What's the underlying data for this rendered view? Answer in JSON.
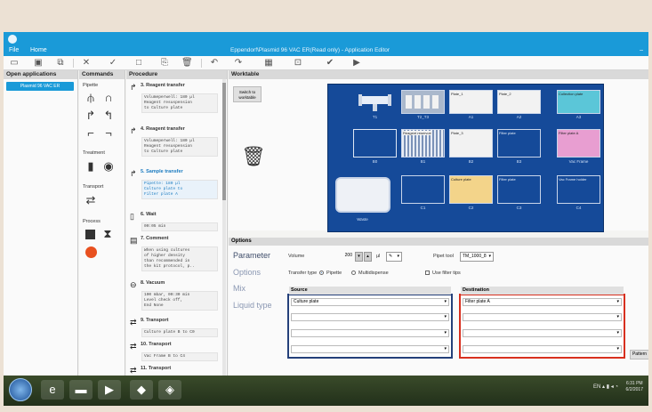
{
  "window": {
    "title": "Eppendorf\\Plasmid 96 VAC ER(Read only) - Application Editor",
    "menu": [
      "File",
      "Home"
    ]
  },
  "toolbar": {
    "icons": [
      "save-icon",
      "save-as-icon",
      "copy-icon",
      "close-icon",
      "check-icon",
      "new-icon",
      "paste-icon",
      "delete-icon",
      "undo-icon",
      "redo-icon",
      "table-icon",
      "preview-icon",
      "validate-icon",
      "run-icon"
    ]
  },
  "open_applications": {
    "header": "Open applications",
    "active_app": "Plasmid 96 VAC ER"
  },
  "commands": {
    "header": "Commands",
    "groups": {
      "pipette": "Pipette",
      "treatment": "Treatment",
      "transport": "Transport",
      "process": "Process"
    }
  },
  "procedure": {
    "header": "Procedure",
    "steps": [
      {
        "title": "3. Reagent transfer",
        "text": "Volumeperwell: 180 µl\nReagent resuspension\nto Culture plate"
      },
      {
        "title": "4. Reagent transfer",
        "text": "Volumeperwell: 180 µl\nReagent resuspension\nto Culture plate"
      },
      {
        "title": "5. Sample transfer",
        "text": "Pipette: 180 µl\nCulture plate to\nFilter plate A"
      },
      {
        "title": "6. Wait",
        "text": "00:05 min"
      },
      {
        "title": "7. Comment",
        "text": "When using cultures\nof higher density\nthan recommended in\nthe kit protocol, p.."
      },
      {
        "title": "8. Vacuum",
        "text": "100 mbar, 00:30 min\nLevel check off,\nEnd None"
      },
      {
        "title": "9. Transport",
        "text": "Culture plate B to C0"
      },
      {
        "title": "10. Transport",
        "text": "Vac Frame B to C4"
      },
      {
        "title": "11. Transport",
        "text": ""
      }
    ]
  },
  "worktable": {
    "header": "Worktable",
    "switch_button": "Switch to worktable",
    "positions": [
      {
        "label": "T1",
        "content": ""
      },
      {
        "label": "T2_T3",
        "content": ""
      },
      {
        "label": "A1",
        "content": "Plate_1"
      },
      {
        "label": "A2",
        "content": "Plate_2"
      },
      {
        "label": "A3",
        "content": "Collection plate"
      },
      {
        "label": "B0",
        "content": ""
      },
      {
        "label": "B1",
        "content": "Reagent reservoir"
      },
      {
        "label": "B2",
        "content": "Plate_3"
      },
      {
        "label": "B3",
        "content": "Filter plate"
      },
      {
        "label": "Vac Frame",
        "content": "Filter plate A"
      },
      {
        "label": "Waste",
        "content": ""
      },
      {
        "label": "C1",
        "content": ""
      },
      {
        "label": "C2",
        "content": "Culture plate"
      },
      {
        "label": "C3",
        "content": "Filter plate"
      },
      {
        "label": "C4",
        "content": "Vac Frame holder"
      }
    ]
  },
  "options": {
    "header": "Options",
    "labels": {
      "parameter": "Parameter",
      "options": "Options",
      "mix": "Mix",
      "liquid_type": "Liquid type"
    },
    "volume_label": "Volume",
    "volume_value": "200",
    "volume_unit": "µl",
    "pipet_tool_label": "Pipet tool",
    "pipet_tool_value": "TM_1000_8",
    "transfer_type_label": "Transfer type",
    "transfer_types": [
      "Pipette",
      "Multidispense"
    ],
    "use_filter_tips": "Use filter tips",
    "source_header": "Source",
    "destination_header": "Destination",
    "source_rows": [
      "Culture plate",
      "",
      "",
      ""
    ],
    "destination_rows": [
      "Filter plate A",
      "",
      "",
      ""
    ],
    "pattern_button": "Pattern"
  },
  "taskbar": {
    "time": "6:31 PM",
    "date": "6/2/2017",
    "tray": "EN"
  }
}
